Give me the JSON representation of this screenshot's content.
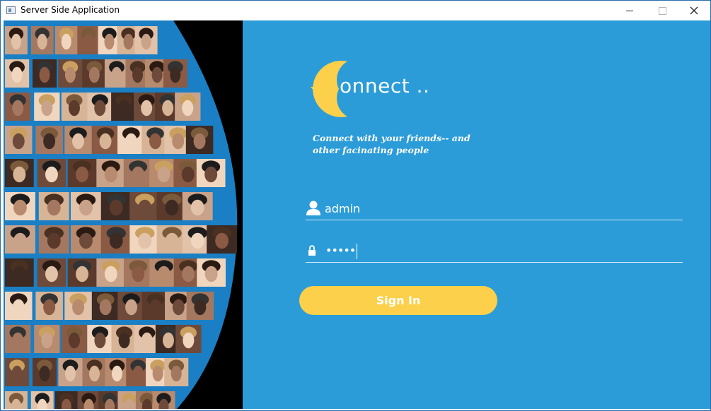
{
  "window": {
    "title": "Server Side Application"
  },
  "colors": {
    "panel_bg": "#2b9cd8",
    "accent_yellow": "#fcd04a",
    "text_white": "#ffffff"
  },
  "icons": {
    "app": "app-window-icon",
    "user": "user-icon",
    "password": "lock-icon",
    "logo": "crescent-c-logo"
  },
  "brand": {
    "logo_text": "onnect ..",
    "tagline": "Connect with your friends-- and other facinating people"
  },
  "form": {
    "username_value": "admin",
    "password_masked": "•••••",
    "signin_label": "Sign In"
  }
}
